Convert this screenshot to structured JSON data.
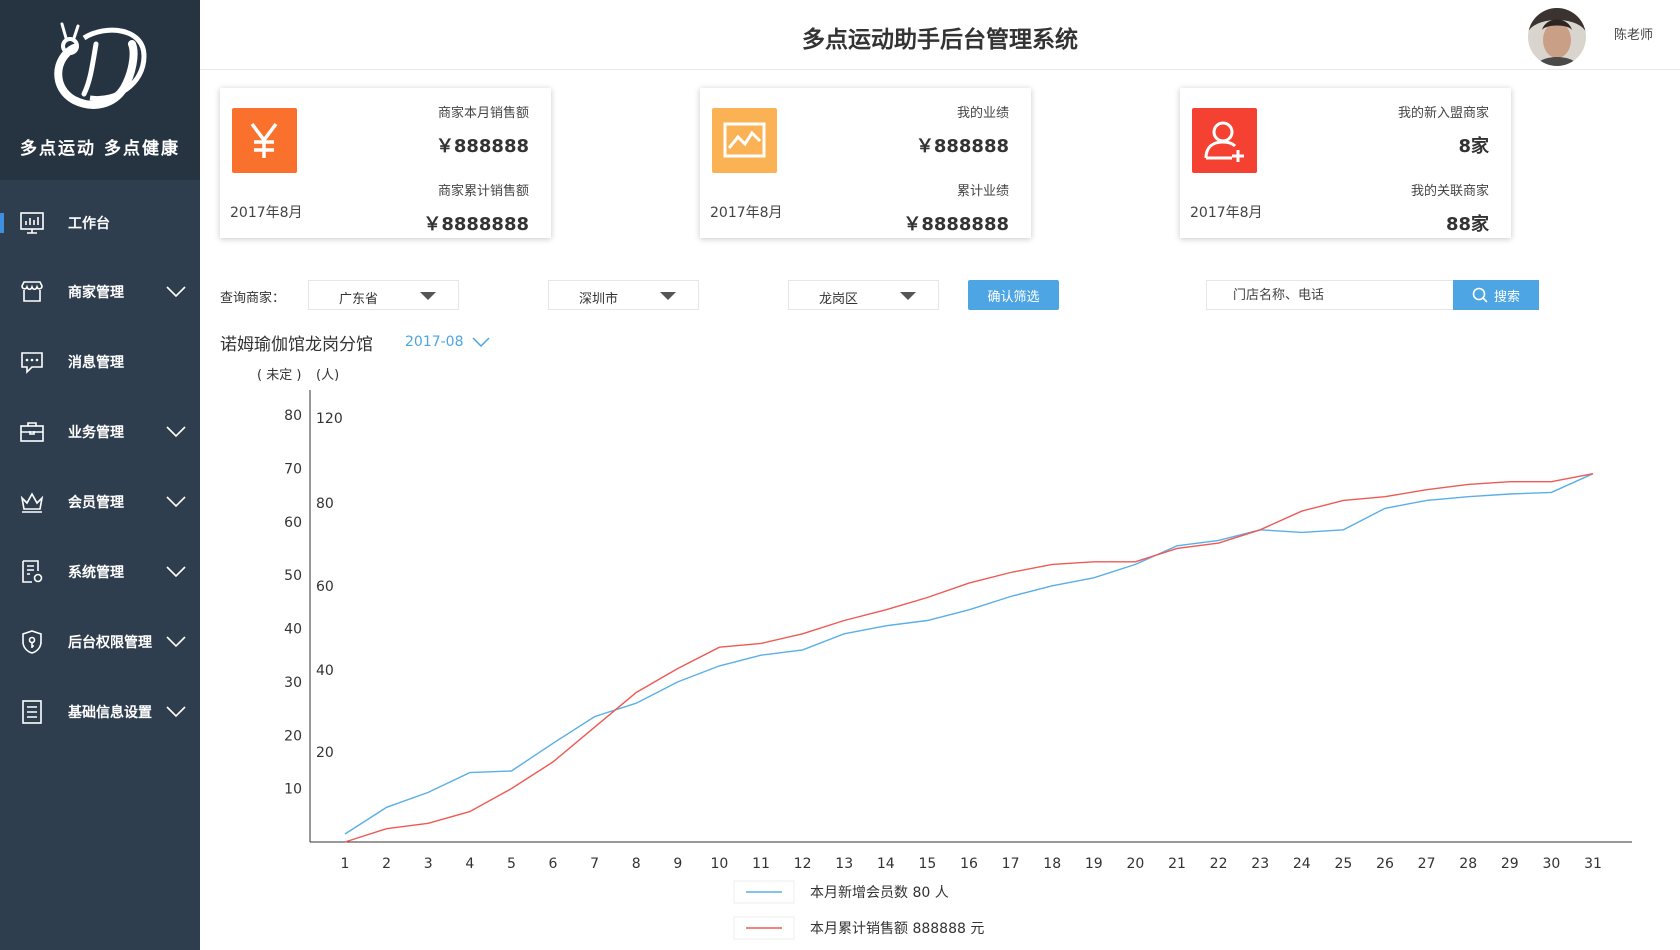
{
  "sidebar": {
    "logo_text": "多点运动 多点健康",
    "items": [
      {
        "label": "工作台",
        "icon": "dashboard-monitor-icon",
        "active": true,
        "has_submenu": false
      },
      {
        "label": "商家管理",
        "icon": "store-icon",
        "active": false,
        "has_submenu": true
      },
      {
        "label": "消息管理",
        "icon": "message-icon",
        "active": false,
        "has_submenu": false
      },
      {
        "label": "业务管理",
        "icon": "briefcase-icon",
        "active": false,
        "has_submenu": true
      },
      {
        "label": "会员管理",
        "icon": "crown-icon",
        "active": false,
        "has_submenu": true
      },
      {
        "label": "系统管理",
        "icon": "settings-doc-icon",
        "active": false,
        "has_submenu": true
      },
      {
        "label": "后台权限管理",
        "icon": "shield-key-icon",
        "active": false,
        "has_submenu": true
      },
      {
        "label": "基础信息设置",
        "icon": "list-doc-icon",
        "active": false,
        "has_submenu": true
      }
    ]
  },
  "header": {
    "title": "多点运动助手后台管理系统",
    "username": "陈老师"
  },
  "cards": [
    {
      "date": "2017年8月",
      "label1": "商家本月销售额",
      "value1": "￥888888",
      "label2": "商家累计销售额",
      "value2": "￥8888888",
      "icon": "yen-icon",
      "color": "#f9712d"
    },
    {
      "date": "2017年8月",
      "label1": "我的业绩",
      "value1": "￥888888",
      "label2": "累计业绩",
      "value2": "￥8888888",
      "icon": "line-chart-icon",
      "color": "#fbb255"
    },
    {
      "date": "2017年8月",
      "label1": "我的新入盟商家",
      "value1": "8家",
      "label2": "我的关联商家",
      "value2": "88家",
      "icon": "add-user-icon",
      "color": "#f54131"
    }
  ],
  "filter": {
    "label": "查询商家：",
    "province": "广东省",
    "city": "深圳市",
    "district": "龙岗区",
    "confirm_label": "确认筛选",
    "search_placeholder": "门店名称、电话",
    "search_label": "搜索"
  },
  "store": {
    "name": "诺姆瑜伽馆龙岗分馆",
    "month": "2017-08"
  },
  "chart_data": {
    "type": "line",
    "title": "",
    "left_axis_label": "( 未定 )",
    "left_axis_ticks": [
      "10",
      "20",
      "30",
      "40",
      "50",
      "60",
      "70",
      "80"
    ],
    "right_axis_label": "(人)",
    "right_axis_ticks": [
      "20",
      "40",
      "60",
      "80",
      "120"
    ],
    "xlabel": "",
    "x": [
      1,
      2,
      3,
      4,
      5,
      6,
      7,
      8,
      9,
      10,
      11,
      12,
      13,
      14,
      15,
      16,
      17,
      18,
      19,
      20,
      21,
      22,
      23,
      24,
      25,
      26,
      27,
      28,
      29,
      30,
      31
    ],
    "ylim": [
      0,
      80
    ],
    "grid": false,
    "legend_position": "bottom",
    "series": [
      {
        "name": "本月新增会员数 80 人",
        "color": "#5aafe6",
        "values": [
          1.5,
          6.5,
          9.3,
          13,
          13.3,
          18.5,
          23.5,
          26,
          30,
          33,
          35,
          36,
          39,
          40.5,
          41.5,
          43.5,
          46,
          48,
          49.5,
          52,
          55.5,
          56.5,
          58.5,
          58,
          58.5,
          62.5,
          64,
          64.7,
          65.2,
          65.5,
          69
        ]
      },
      {
        "name": "本月累计销售额 888888 元",
        "color": "#ee5a55",
        "values": [
          0,
          2.5,
          3.5,
          5.7,
          10,
          15,
          21.5,
          28,
          32.5,
          36.5,
          37.2,
          39,
          41.5,
          43.5,
          45.8,
          48.5,
          50.5,
          52,
          52.5,
          52.5,
          55,
          56,
          58.5,
          62,
          64,
          64.7,
          66,
          67,
          67.5,
          67.5,
          69
        ]
      }
    ]
  }
}
